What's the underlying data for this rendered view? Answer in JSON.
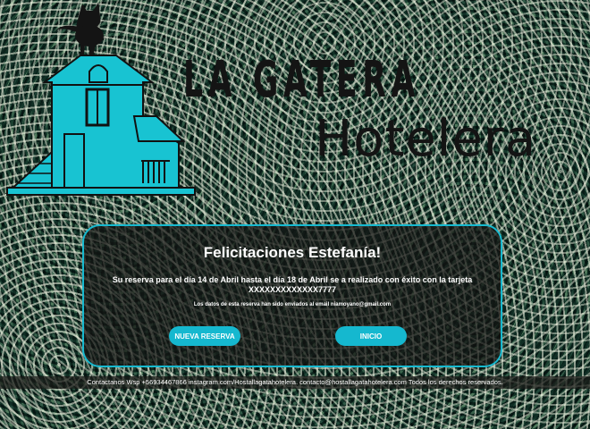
{
  "brand": {
    "name_top": "LA GATERA",
    "name_bottom": "Hotelera",
    "accent_color": "#15b8cf"
  },
  "icons": {
    "logo": "house-with-cat-logo"
  },
  "confirmation": {
    "title": "Felicitaciones Estefanía!",
    "message": "Su reserva para el día 14 de Abril hasta el día 18 de Abril se a realizado con éxito con la tarjeta XXXXXXXXXXXXX7777",
    "email_note": "Los datos de esta reserva han sido enviados al email niamoyano@gmail.com",
    "new_booking_label": "NUEVA RESERVA",
    "home_label": "INICIO"
  },
  "footer": {
    "text": "Contactanos Wsp +56934467866 instagram.com/Hostallagatahotelera. contacto@hostallagatahotelera.com Todos los derechos reservados."
  }
}
